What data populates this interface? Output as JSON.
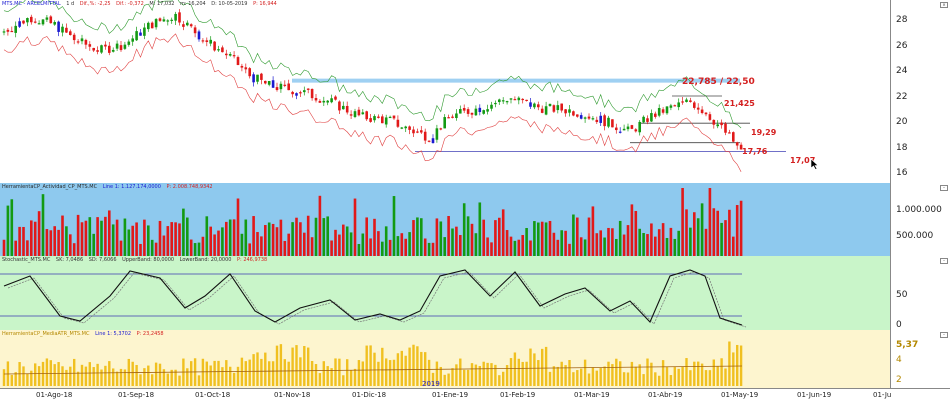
{
  "price_panel": {
    "header": {
      "symbol": "MTS.MC - ARCELMITTAL",
      "period": "1 d",
      "change_pct": "Dif.,%: -2,25",
      "change_abs": "Dif.: -0,372",
      "max": "M: 17,032",
      "min": "m: 16,204",
      "date": "D: 10-05-2019",
      "last": "P: 16,944"
    },
    "y_ticks": [
      "28",
      "26",
      "24",
      "22",
      "20",
      "18",
      "16"
    ],
    "levels": {
      "resistance_top": "22,785 / 22,50",
      "level_1": "21,425",
      "level_2": "19,29",
      "level_3": "17,76",
      "level_4": "17,07"
    },
    "colors": {
      "up": "#139a13",
      "down": "#e11919",
      "inside": "#1a1ad0",
      "upper_band": "#2e9a2e",
      "lower_band": "#e04040",
      "resistance": "#9fd0f2",
      "support": "#7070c8"
    }
  },
  "activity_panel": {
    "header": {
      "name": "HerramientaCP_Actividad_CP_MTS.MC",
      "line": "Line 1: 1.127.174,0000",
      "last": "P: 2.008.748,9342"
    },
    "y_ticks": [
      "1.000.000",
      "500.000"
    ],
    "bg": "#8ec9ee"
  },
  "stochastic_panel": {
    "header": {
      "name": "Stochastic_MTS.MC",
      "sk": "SK: 7,0486",
      "sd": "SD: 7,6066",
      "upper": "UpperBand: 80,0000",
      "lower": "LowerBand: 20,0000",
      "last": "P: 246,9738"
    },
    "y_ticks": [
      "50",
      "0"
    ],
    "bg": "#c9f5c9"
  },
  "atr_panel": {
    "header": {
      "name": "HerramientaCP_MediaATR_MTS.MC",
      "line": "Line 1: 5,3702",
      "last": "P: 23,2458"
    },
    "y_ticks": [
      "5,37",
      "4",
      "2"
    ],
    "year_label": "2019",
    "bg": "#fdf5cf"
  },
  "time_axis": [
    "01-Ago-18",
    "01-Sep-18",
    "01-Oct-18",
    "01-Nov-18",
    "01-Dic-18",
    "01-Ene-19",
    "01-Feb-19",
    "01-Mar-19",
    "01-Abr-19",
    "01-May-19",
    "01-Jun-19",
    "01-Ju"
  ]
}
